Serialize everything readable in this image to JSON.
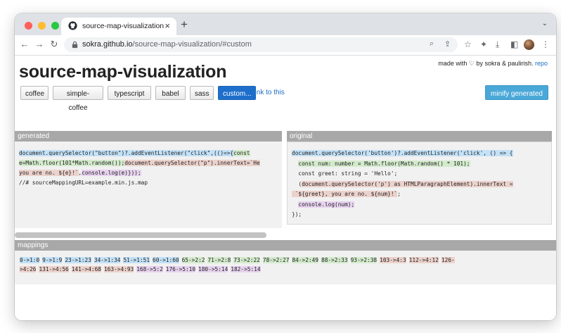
{
  "browser": {
    "tab_title": "source-map-visualization",
    "tab_close": "×",
    "new_tab": "+",
    "tab_menu": "⌄",
    "url_host": "sokra.github.io",
    "url_path": "/source-map-visualization/#custom",
    "nav": {
      "back": "←",
      "forward": "→",
      "reload": "↻"
    }
  },
  "header": {
    "made_with_prefix": "made with ♡ by sokra & paulirish.",
    "repo_link": "repo",
    "title": "source-map-visualization"
  },
  "buttons": [
    {
      "label": "coffee",
      "active": false
    },
    {
      "label": "simple-coffee",
      "active": false
    },
    {
      "label": "typescript",
      "active": false
    },
    {
      "label": "babel",
      "active": false
    },
    {
      "label": "sass",
      "active": false
    },
    {
      "label": "custom...",
      "active": true
    }
  ],
  "link_to_this": "Link to this",
  "minify_button": "minify generated",
  "generated": {
    "header": "generated",
    "lines": [
      [
        {
          "t": "document.querySelector(\"button\")?.addEventListener(\"click\",(()=>{",
          "c": "blue"
        },
        {
          "t": "const",
          "c": "green"
        }
      ],
      [
        {
          "t": "e=Math.floor(101*Math.random());",
          "c": "green"
        },
        {
          "t": "document.querySelector(\"p\").innerText=`He",
          "c": "red"
        }
      ],
      [
        {
          "t": "you are no. ${e}!`",
          "c": "red"
        },
        {
          "t": ",",
          "c": ""
        },
        {
          "t": "console.log(e)}));",
          "c": "purple"
        }
      ],
      [
        {
          "t": "//# sourceMappingURL=example.min.js.map",
          "c": ""
        }
      ]
    ]
  },
  "original": {
    "header": "original",
    "lines": [
      [
        {
          "t": "document.querySelector('button')?.addEventListener('click', () => {",
          "c": "blue"
        }
      ],
      [
        {
          "t": "  ",
          "c": ""
        },
        {
          "t": "const num: number = Math.floor(Math.random() * 101);",
          "c": "green"
        }
      ],
      [
        {
          "t": "  const greet: string = 'Hello';",
          "c": ""
        }
      ],
      [
        {
          "t": "  (",
          "c": ""
        },
        {
          "t": "document.querySelector('p') as HTMLParagraphElement).innerText =",
          "c": "red"
        }
      ],
      [
        {
          "t": " `${greet}, you are no. ${num}!`",
          "c": "red"
        },
        {
          "t": ";",
          "c": ""
        }
      ],
      [
        {
          "t": "  ",
          "c": ""
        },
        {
          "t": "console.log(num);",
          "c": "purple"
        }
      ],
      [
        {
          "t": "});",
          "c": ""
        }
      ]
    ]
  },
  "mappings": {
    "header": "mappings",
    "row1": [
      {
        "t": "0->1:0",
        "c": "blue"
      },
      {
        "t": "9->1:9",
        "c": "blue"
      },
      {
        "t": "23->1:23",
        "c": "blue"
      },
      {
        "t": "34->1:34",
        "c": "blue"
      },
      {
        "t": "51->1:51",
        "c": "blue"
      },
      {
        "t": "60->1:60",
        "c": "blue"
      },
      {
        "t": "65->2:2",
        "c": "green"
      },
      {
        "t": "71->2:8",
        "c": "green"
      },
      {
        "t": "73->2:22",
        "c": "green"
      },
      {
        "t": "78->2:27",
        "c": "green"
      },
      {
        "t": "84->2:49",
        "c": "green"
      },
      {
        "t": "88->2:33",
        "c": "green"
      },
      {
        "t": "93->2:38",
        "c": "green"
      },
      {
        "t": "103->4:3",
        "c": "red"
      },
      {
        "t": "112->4:12",
        "c": "red"
      },
      {
        "t": "126-",
        "c": "red"
      }
    ],
    "row2": [
      {
        "t": ">4:26",
        "c": "red"
      },
      {
        "t": "131->4:56",
        "c": "red"
      },
      {
        "t": "141->4:68",
        "c": "red"
      },
      {
        "t": "163->4:93",
        "c": "red"
      },
      {
        "t": "168->5:2",
        "c": "purple"
      },
      {
        "t": "176->5:10",
        "c": "purple"
      },
      {
        "t": "180->5:14",
        "c": "purple"
      },
      {
        "t": "182->5:14",
        "c": "purple"
      }
    ]
  },
  "colors": {
    "blue": "#c3e1f7",
    "green": "#d3ebcc",
    "red": "#ecd2cc",
    "purple": "#e7d2ef",
    "active_button": "#1e6fcb",
    "minify": "#4aa8d8"
  }
}
